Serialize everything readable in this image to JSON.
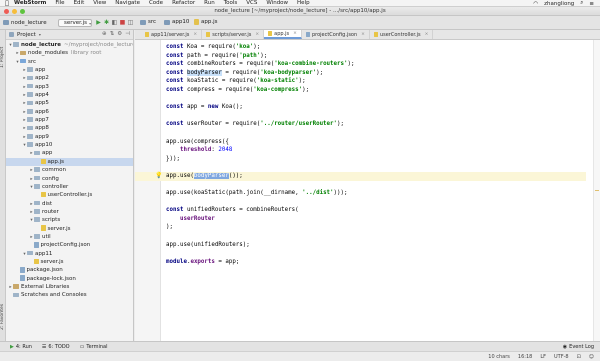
{
  "menubar": {
    "app": "WebStorm",
    "items": [
      "File",
      "Edit",
      "View",
      "Navigate",
      "Code",
      "Refactor",
      "Run",
      "Tools",
      "VCS",
      "Window",
      "Help"
    ],
    "user": "zhangliong"
  },
  "window_title": "node_lecture [~/myproject/node_lecture] - .../src/app10/app.js",
  "toolbar": {
    "breadcrumbs": [
      "node_lecture",
      "src",
      "app10",
      "app.js"
    ],
    "run_config": "server.js"
  },
  "project_panel": {
    "title": "Project",
    "rows": [
      {
        "indent": 0,
        "arrow": "▾",
        "kind": "folder",
        "label": "node_lecture",
        "dim": "~/myproject/node_lecture",
        "bold": true
      },
      {
        "indent": 1,
        "arrow": "▸",
        "kind": "folder-lib",
        "label": "node_modules",
        "dim": "library root"
      },
      {
        "indent": 1,
        "arrow": "▾",
        "kind": "folder-src",
        "label": "src",
        "dim": ""
      },
      {
        "indent": 2,
        "arrow": "▸",
        "kind": "folder",
        "label": "app",
        "dim": ""
      },
      {
        "indent": 2,
        "arrow": "▸",
        "kind": "folder",
        "label": "app2",
        "dim": ""
      },
      {
        "indent": 2,
        "arrow": "▸",
        "kind": "folder",
        "label": "app3",
        "dim": ""
      },
      {
        "indent": 2,
        "arrow": "▸",
        "kind": "folder",
        "label": "app4",
        "dim": ""
      },
      {
        "indent": 2,
        "arrow": "▸",
        "kind": "folder",
        "label": "app5",
        "dim": ""
      },
      {
        "indent": 2,
        "arrow": "▸",
        "kind": "folder",
        "label": "app6",
        "dim": ""
      },
      {
        "indent": 2,
        "arrow": "▸",
        "kind": "folder",
        "label": "app7",
        "dim": ""
      },
      {
        "indent": 2,
        "arrow": "▸",
        "kind": "folder",
        "label": "app8",
        "dim": ""
      },
      {
        "indent": 2,
        "arrow": "▸",
        "kind": "folder",
        "label": "app9",
        "dim": ""
      },
      {
        "indent": 2,
        "arrow": "▾",
        "kind": "folder",
        "label": "app10",
        "dim": ""
      },
      {
        "indent": 3,
        "arrow": "▸",
        "kind": "folder",
        "label": "app",
        "dim": ""
      },
      {
        "indent": 4,
        "arrow": "",
        "kind": "file-js",
        "label": "app.js",
        "dim": "",
        "selected": true
      },
      {
        "indent": 3,
        "arrow": "▸",
        "kind": "folder",
        "label": "common",
        "dim": ""
      },
      {
        "indent": 3,
        "arrow": "▸",
        "kind": "folder",
        "label": "config",
        "dim": ""
      },
      {
        "indent": 3,
        "arrow": "▾",
        "kind": "folder",
        "label": "controller",
        "dim": ""
      },
      {
        "indent": 4,
        "arrow": "",
        "kind": "file-js",
        "label": "userController.js",
        "dim": ""
      },
      {
        "indent": 3,
        "arrow": "▸",
        "kind": "folder",
        "label": "dist",
        "dim": ""
      },
      {
        "indent": 3,
        "arrow": "▸",
        "kind": "folder",
        "label": "router",
        "dim": ""
      },
      {
        "indent": 3,
        "arrow": "▾",
        "kind": "folder",
        "label": "scripts",
        "dim": ""
      },
      {
        "indent": 4,
        "arrow": "",
        "kind": "file-js",
        "label": "server.js",
        "dim": ""
      },
      {
        "indent": 3,
        "arrow": "▸",
        "kind": "folder",
        "label": "util",
        "dim": ""
      },
      {
        "indent": 3,
        "arrow": "",
        "kind": "file-json",
        "label": "projectConfig.json",
        "dim": ""
      },
      {
        "indent": 2,
        "arrow": "▾",
        "kind": "folder",
        "label": "app11",
        "dim": ""
      },
      {
        "indent": 3,
        "arrow": "",
        "kind": "file-js",
        "label": "server.js",
        "dim": ""
      },
      {
        "indent": 1,
        "arrow": "",
        "kind": "file-json",
        "label": "package.json",
        "dim": ""
      },
      {
        "indent": 1,
        "arrow": "",
        "kind": "file-json",
        "label": "package-lock.json",
        "dim": ""
      },
      {
        "indent": 0,
        "arrow": "▸",
        "kind": "folder-lib",
        "label": "External Libraries",
        "dim": ""
      },
      {
        "indent": 0,
        "arrow": "",
        "kind": "folder",
        "label": "Scratches and Consoles",
        "dim": ""
      }
    ]
  },
  "editor_tabs": [
    {
      "label": "app11/server.js",
      "active": false
    },
    {
      "label": "scripts/server.js",
      "active": false
    },
    {
      "label": "app.js",
      "active": true
    },
    {
      "label": "projectConfig.json",
      "active": false
    },
    {
      "label": "userController.js",
      "active": false
    }
  ],
  "code_lines": [
    "const Koa = require('koa');",
    "const path = require('path');",
    "const combineRouters = require('koa-combine-routers');",
    "const bodyParser = require('koa-bodyparser');",
    "const koaStatic = require('koa-static');",
    "const compress = require('koa-compress');",
    "",
    "const app = new Koa();",
    "",
    "const userRouter = require('../router/userRouter');",
    "",
    "app.use(compress({",
    "    threshold: 2048",
    "}));",
    "",
    "app.use(bodyParser());",
    "",
    "app.use(koaStatic(path.join(__dirname, '../dist')));",
    "",
    "const unifiedRouters = combineRouters(",
    "    userRouter",
    ");",
    "",
    "app.use(unifiedRouters);",
    "",
    "module.exports = app;"
  ],
  "bottom_tools": [
    "4: Run",
    "6: TODO",
    "Terminal"
  ],
  "event_log": "Event Log",
  "status": {
    "chars": "10 chars",
    "position": "16:18",
    "line_sep": "LF",
    "encoding": "UTF-8"
  }
}
